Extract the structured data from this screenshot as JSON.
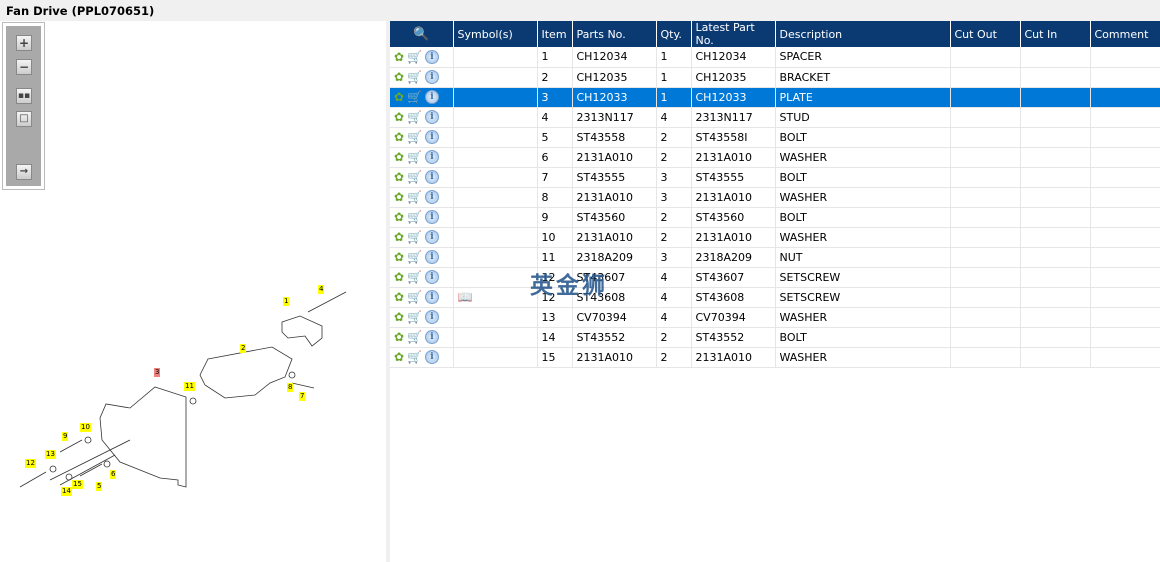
{
  "title": "Fan Drive (PPL070651)",
  "toolbar": {
    "zoom_in": "zoom-in",
    "zoom_out": "zoom-out",
    "fit": "fit",
    "actual": "actual",
    "export": "export"
  },
  "columns": [
    "",
    "Symbol(s)",
    "Item",
    "Parts No.",
    "Qty.",
    "Latest Part No.",
    "Description",
    "Cut Out",
    "Cut In",
    "Comment"
  ],
  "rows": [
    {
      "item": "1",
      "part": "CH12034",
      "qty": "1",
      "latest": "CH12034",
      "desc": "SPACER"
    },
    {
      "item": "2",
      "part": "CH12035",
      "qty": "1",
      "latest": "CH12035",
      "desc": "BRACKET"
    },
    {
      "item": "3",
      "part": "CH12033",
      "qty": "1",
      "latest": "CH12033",
      "desc": "PLATE",
      "selected": true
    },
    {
      "item": "4",
      "part": "2313N117",
      "qty": "4",
      "latest": "2313N117",
      "desc": "STUD"
    },
    {
      "item": "5",
      "part": "ST43558",
      "qty": "2",
      "latest": "ST43558I",
      "desc": "BOLT"
    },
    {
      "item": "6",
      "part": "2131A010",
      "qty": "2",
      "latest": "2131A010",
      "desc": "WASHER"
    },
    {
      "item": "7",
      "part": "ST43555",
      "qty": "3",
      "latest": "ST43555",
      "desc": "BOLT"
    },
    {
      "item": "8",
      "part": "2131A010",
      "qty": "3",
      "latest": "2131A010",
      "desc": "WASHER"
    },
    {
      "item": "9",
      "part": "ST43560",
      "qty": "2",
      "latest": "ST43560",
      "desc": "BOLT"
    },
    {
      "item": "10",
      "part": "2131A010",
      "qty": "2",
      "latest": "2131A010",
      "desc": "WASHER"
    },
    {
      "item": "11",
      "part": "2318A209",
      "qty": "3",
      "latest": "2318A209",
      "desc": "NUT"
    },
    {
      "item": "12",
      "part": "ST43607",
      "qty": "4",
      "latest": "ST43607",
      "desc": "SETSCREW"
    },
    {
      "item": "12",
      "part": "ST43608",
      "qty": "4",
      "latest": "ST43608",
      "desc": "SETSCREW",
      "symbol": "book"
    },
    {
      "item": "13",
      "part": "CV70394",
      "qty": "4",
      "latest": "CV70394",
      "desc": "WASHER"
    },
    {
      "item": "14",
      "part": "ST43552",
      "qty": "2",
      "latest": "ST43552",
      "desc": "BOLT"
    },
    {
      "item": "15",
      "part": "2131A010",
      "qty": "2",
      "latest": "2131A010",
      "desc": "WASHER"
    }
  ],
  "watermark": "英金狮",
  "callouts": [
    "1",
    "4",
    "2",
    "3",
    "11",
    "8",
    "7",
    "10",
    "9",
    "13",
    "12",
    "6",
    "15",
    "5",
    "14"
  ],
  "colors": {
    "header": "#0b3a72",
    "selected": "#0078d7",
    "callout": "#ffff00",
    "callout_selected": "#f08080"
  }
}
